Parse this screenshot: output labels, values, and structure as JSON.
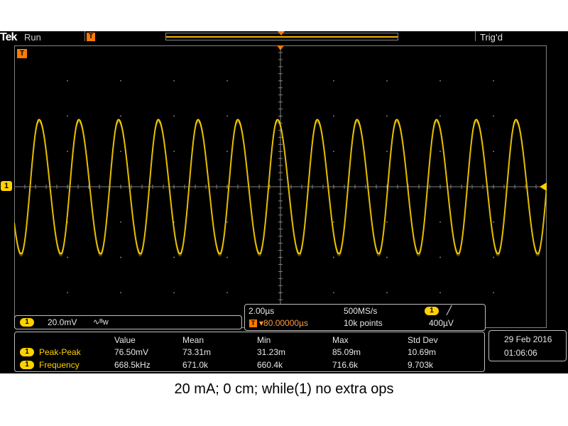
{
  "top_bar": {
    "brand": "Tek",
    "run_state": "Run",
    "trigger_state": "Trig’d"
  },
  "markers": {
    "channel": "1",
    "trigger_position": "T"
  },
  "channel_box": {
    "badge": "1",
    "scale": "20.0mV",
    "coupling_icon": "∿ᴮw"
  },
  "timebase_box": {
    "time_per_div": "2.00µs",
    "sample_rate": "500MS/s",
    "trigger_badge": "1",
    "trigger_slope_icon": "rising-edge",
    "trigger_slope_glyph": "╱",
    "delay": "▾80.00000µs",
    "record_length": "10k points",
    "trigger_level": "400µV"
  },
  "measurements": {
    "headers": [
      "Value",
      "Mean",
      "Min",
      "Max",
      "Std Dev"
    ],
    "rows": [
      {
        "badge": "1",
        "name": "Peak-Peak",
        "values": [
          "76.50mV",
          "73.31m",
          "31.23m",
          "85.09m",
          "10.69m"
        ]
      },
      {
        "badge": "1",
        "name": "Frequency",
        "values": [
          "668.5kHz",
          "671.0k",
          "660.4k",
          "716.6k",
          "9.703k"
        ]
      }
    ]
  },
  "datetime": {
    "date": "29 Feb  2016",
    "time": "01:06:06"
  },
  "caption": "20 mA; 0 cm; while(1) no extra ops",
  "colors": {
    "trace": "#ffd200",
    "grid": "#808080",
    "trigger_marker": "#ff7a00",
    "background": "#000000"
  },
  "waveform": {
    "cycles_on_screen": 13.4,
    "amplitude_divisions": 1.9,
    "first_peak_fraction": 0.0467
  }
}
